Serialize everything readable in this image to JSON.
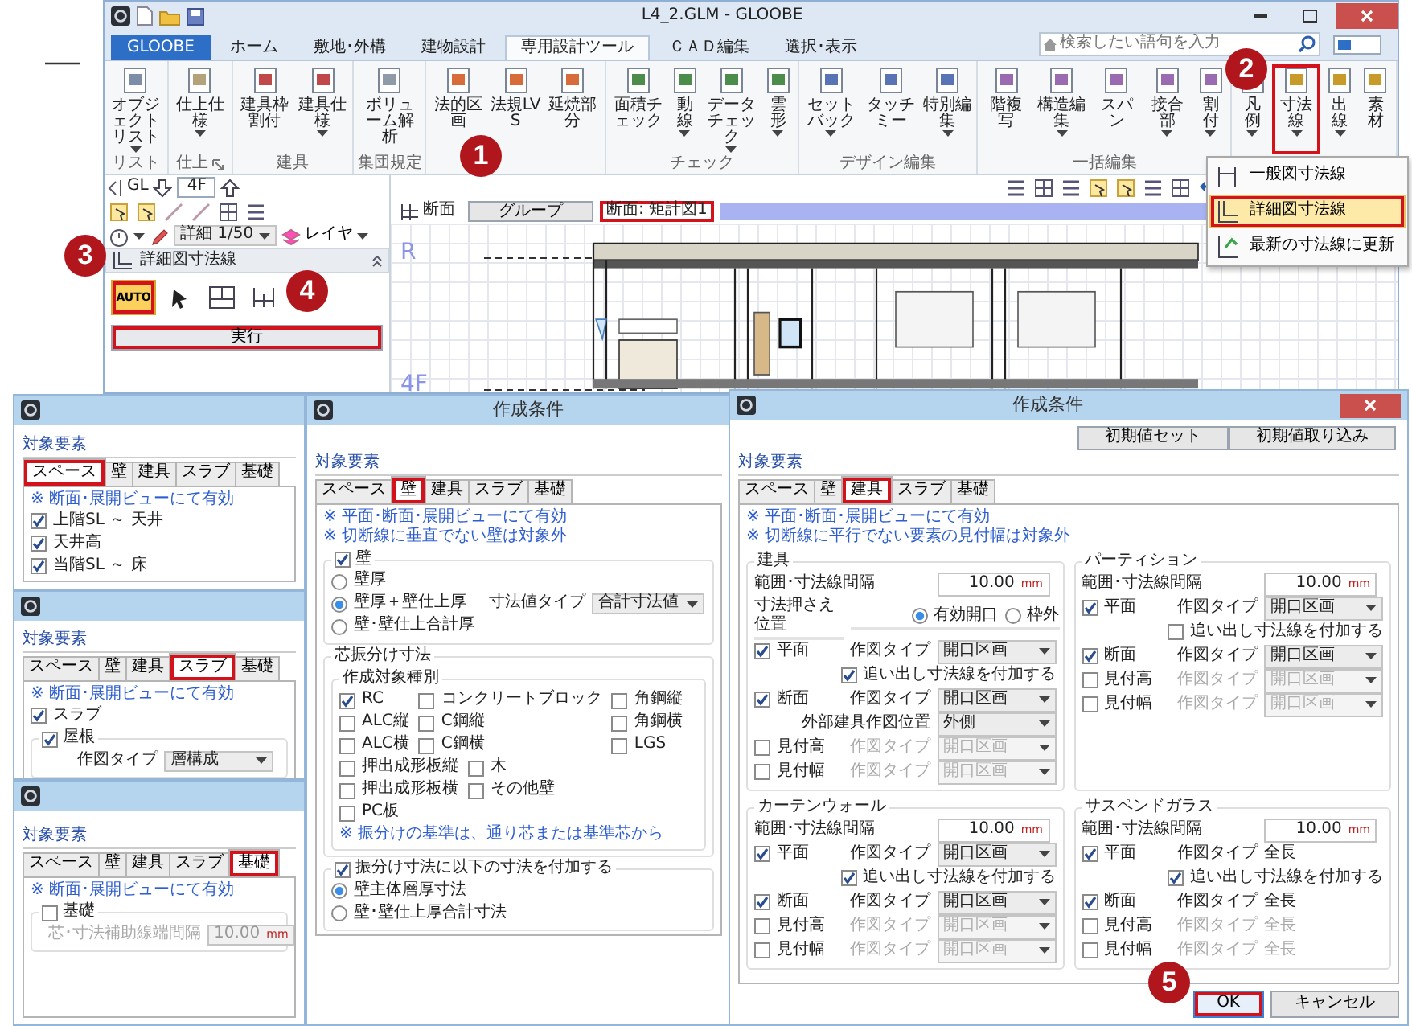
{
  "app": {
    "title": "L4_2.GLM - GLOOBE",
    "ribbon_tabs": [
      {
        "label": "GLOOBE",
        "kind": "file",
        "selected": false
      },
      {
        "label": "ホーム",
        "kind": "tab",
        "selected": false
      },
      {
        "label": "敷地･外構",
        "kind": "tab",
        "selected": false
      },
      {
        "label": "建物設計",
        "kind": "tab",
        "selected": false
      },
      {
        "label": "専用設計ツール",
        "kind": "tab",
        "selected": true
      },
      {
        "label": "ＣＡＤ編集",
        "kind": "tab",
        "selected": false
      },
      {
        "label": "選択･表示",
        "kind": "tab",
        "selected": false
      }
    ],
    "search": {
      "placeholder": "検索したい語句を入力"
    },
    "ribbon_groups": [
      {
        "label": "リスト",
        "launcher": false,
        "buttons": [
          {
            "label": "オブジェクトリスト",
            "dropdown": true,
            "highlighted": false
          }
        ]
      },
      {
        "label": "仕上",
        "launcher": true,
        "buttons": [
          {
            "label": "仕上仕様",
            "dropdown": true,
            "highlighted": false
          }
        ]
      },
      {
        "label": "建具",
        "launcher": false,
        "buttons": [
          {
            "label": "建具枠割付",
            "dropdown": false,
            "highlighted": false
          },
          {
            "label": "建具仕様",
            "dropdown": true,
            "highlighted": false
          }
        ]
      },
      {
        "label": "集団規定",
        "launcher": false,
        "buttons": [
          {
            "label": "ボリューム解析",
            "dropdown": false,
            "highlighted": false
          }
        ]
      },
      {
        "launcher": false,
        "buttons": [
          {
            "label": "法的区画",
            "dropdown": false,
            "highlighted": false
          },
          {
            "label": "法規LVS",
            "dropdown": false,
            "highlighted": false
          },
          {
            "label": "延焼部分",
            "dropdown": false,
            "highlighted": false
          }
        ]
      },
      {
        "label": "チェック",
        "launcher": false,
        "buttons": [
          {
            "label": "面積チェック",
            "dropdown": false,
            "highlighted": false
          },
          {
            "label": "動線",
            "dropdown": true,
            "highlighted": false
          },
          {
            "label": "データチェック",
            "dropdown": true,
            "highlighted": false
          },
          {
            "label": "雲形",
            "dropdown": true,
            "highlighted": false
          }
        ]
      },
      {
        "label": "デザイン編集",
        "launcher": false,
        "buttons": [
          {
            "label": "セットバック",
            "dropdown": true,
            "highlighted": false
          },
          {
            "label": "タッチミー",
            "dropdown": false,
            "highlighted": false
          },
          {
            "label": "特別編集",
            "dropdown": true,
            "highlighted": false
          }
        ]
      },
      {
        "label": "一括編集",
        "launcher": false,
        "buttons": [
          {
            "label": "階複写",
            "dropdown": false,
            "highlighted": false
          },
          {
            "label": "構造編集",
            "dropdown": true,
            "highlighted": false
          },
          {
            "label": "スパン",
            "dropdown": false,
            "highlighted": false
          },
          {
            "label": "接合部",
            "dropdown": true,
            "highlighted": false
          },
          {
            "label": "割付",
            "dropdown": true,
            "highlighted": false
          }
        ]
      },
      {
        "launcher": false,
        "buttons": [
          {
            "label": "凡例",
            "dropdown": true,
            "highlighted": false
          },
          {
            "label": "寸法線",
            "dropdown": true,
            "highlighted": true
          },
          {
            "label": "出線",
            "dropdown": true,
            "highlighted": false
          },
          {
            "label": "素材",
            "dropdown": false,
            "highlighted": false
          }
        ]
      }
    ],
    "floor_bar": {
      "level": "GL",
      "floor": "4F"
    },
    "view_bar": {
      "view_tab": "断面",
      "group_button": "グループ",
      "view_name": "断面: 矩計図1",
      "highlighted": true
    },
    "scale": "詳細 1/50",
    "layer": "レイヤ",
    "panel": {
      "title": "詳細図寸法線",
      "tools": [
        {
          "kind": "auto",
          "label": "AUTO",
          "selected": true,
          "highlighted": true
        },
        {
          "kind": "pointer",
          "selected": false,
          "highlighted": false
        },
        {
          "kind": "rooms",
          "selected": false,
          "highlighted": false
        },
        {
          "kind": "span",
          "selected": false,
          "highlighted": false
        }
      ],
      "run_button": {
        "label": "実行",
        "highlighted": true
      }
    },
    "canvas": {
      "level_labels": [
        "R",
        "4F"
      ]
    },
    "dimension_menu": [
      {
        "label": "一般図寸法線",
        "selected": false,
        "highlighted": false
      },
      {
        "label": "詳細図寸法線",
        "selected": true,
        "highlighted": true
      },
      {
        "label": "最新の寸法線に更新",
        "selected": false,
        "highlighted": false
      }
    ]
  },
  "callouts": [
    "1",
    "2",
    "3",
    "4",
    "5"
  ],
  "dialogs": [
    {
      "tabs_label": "対象要素",
      "tabs": [
        {
          "label": "スペース",
          "selected": true,
          "highlighted": true
        },
        {
          "label": "壁",
          "selected": false,
          "highlighted": false
        },
        {
          "label": "建具",
          "selected": false,
          "highlighted": false
        },
        {
          "label": "スラブ",
          "selected": false,
          "highlighted": false
        },
        {
          "label": "基礎",
          "selected": false,
          "highlighted": false
        }
      ],
      "items": [
        {
          "kind": "note",
          "text": "※ 断面･展開ビューにて有効"
        },
        {
          "kind": "check",
          "label": "上階SL ～ 天井",
          "checked": true
        },
        {
          "kind": "check",
          "label": "天井高",
          "checked": true
        },
        {
          "kind": "check",
          "label": "当階SL ～ 床",
          "checked": true
        }
      ],
      "closable": false
    },
    {
      "tabs_label": "対象要素",
      "tabs": [
        {
          "label": "スペース",
          "selected": false,
          "highlighted": false
        },
        {
          "label": "壁",
          "selected": false,
          "highlighted": false
        },
        {
          "label": "建具",
          "selected": false,
          "highlighted": false
        },
        {
          "label": "スラブ",
          "selected": true,
          "highlighted": true
        },
        {
          "label": "基礎",
          "selected": false,
          "highlighted": false
        }
      ],
      "items": [
        {
          "kind": "note",
          "text": "※ 断面･展開ビューにて有効"
        },
        {
          "kind": "check",
          "label": "スラブ",
          "checked": true
        },
        {
          "kind": "group",
          "label": "屋根",
          "checked": true,
          "children": [
            {
              "kind": "select",
              "label": "作図タイプ",
              "value": "層構成"
            }
          ]
        }
      ],
      "closable": false
    },
    {
      "tabs_label": "対象要素",
      "tabs": [
        {
          "label": "スペース",
          "selected": false,
          "highlighted": false
        },
        {
          "label": "壁",
          "selected": false,
          "highlighted": false
        },
        {
          "label": "建具",
          "selected": false,
          "highlighted": false
        },
        {
          "label": "スラブ",
          "selected": false,
          "highlighted": false
        },
        {
          "label": "基礎",
          "selected": true,
          "highlighted": true
        }
      ],
      "items": [
        {
          "kind": "note",
          "text": "※ 断面･展開ビューにて有効"
        },
        {
          "kind": "group",
          "label": "基礎",
          "checked": false,
          "children": [
            {
              "kind": "field",
              "label": "芯･寸法補助線端間隔",
              "value": "10.00",
              "unit": "mm",
              "disabled": true
            }
          ]
        }
      ],
      "closable": false
    },
    {
      "title": "作成条件",
      "tabs_label": "対象要素",
      "tabs": [
        {
          "label": "スペース",
          "selected": false,
          "highlighted": false
        },
        {
          "label": "壁",
          "selected": true,
          "highlighted": true
        },
        {
          "label": "建具",
          "selected": false,
          "highlighted": false
        },
        {
          "label": "スラブ",
          "selected": false,
          "highlighted": false
        },
        {
          "label": "基礎",
          "selected": false,
          "highlighted": false
        }
      ],
      "items": [
        {
          "kind": "note",
          "text": "※ 平面･断面･展開ビューにて有効"
        },
        {
          "kind": "note",
          "text": "※ 切断線に垂直でない壁は対象外"
        },
        {
          "kind": "group",
          "label": "壁",
          "checked": true,
          "children": [
            {
              "kind": "radio",
              "label": "壁厚",
              "selected": false
            },
            {
              "kind": "radio",
              "label": "壁厚＋壁仕上厚",
              "selected": true,
              "select": {
                "label": "寸法値タイプ",
                "value": "合計寸法値"
              }
            },
            {
              "kind": "radio",
              "label": "壁･壁仕上合計厚",
              "selected": false
            }
          ]
        },
        {
          "kind": "frame",
          "label": "芯振分け寸法",
          "children": [
            {
              "kind": "frame",
              "label": "作成対象種別",
              "children": [
                {
                  "kind": "grid",
                  "columns": [
                    [
                      {
                        "label": "RC",
                        "checked": true
                      },
                      {
                        "label": "ALC縦",
                        "checked": false
                      },
                      {
                        "label": "ALC横",
                        "checked": false
                      }
                    ],
                    [
                      {
                        "label": "コンクリートブロック",
                        "checked": false
                      },
                      {
                        "label": "C鋼縦",
                        "checked": false
                      },
                      {
                        "label": "C鋼横",
                        "checked": false
                      }
                    ],
                    [
                      {
                        "label": "角鋼縦",
                        "checked": false
                      },
                      {
                        "label": "角鋼横",
                        "checked": false
                      },
                      {
                        "label": "LGS",
                        "checked": false
                      }
                    ],
                    [
                      {
                        "label": "押出成形板縦",
                        "checked": false
                      },
                      {
                        "label": "押出成形板横",
                        "checked": false
                      },
                      {
                        "label": "PC板",
                        "checked": false
                      }
                    ],
                    [
                      {
                        "label": "木",
                        "checked": false
                      },
                      {
                        "label": "その他壁",
                        "checked": false
                      }
                    ]
                  ]
                },
                {
                  "kind": "note",
                  "text": "※ 振分けの基準は、通り芯または基準芯から"
                }
              ]
            }
          ]
        },
        {
          "kind": "group",
          "label": "振分け寸法に以下の寸法を付加する",
          "checked": true,
          "children": [
            {
              "kind": "radio",
              "label": "壁主体層厚寸法",
              "selected": true
            },
            {
              "kind": "radio",
              "label": "壁･壁仕上厚合計寸法",
              "selected": false
            }
          ]
        }
      ],
      "closable": false
    },
    {
      "title": "作成条件",
      "closable": true,
      "top_buttons": [
        "初期値セット",
        "初期値取り込み"
      ],
      "tabs_label": "対象要素",
      "tabs": [
        {
          "label": "スペース",
          "selected": false,
          "highlighted": false
        },
        {
          "label": "壁",
          "selected": false,
          "highlighted": false
        },
        {
          "label": "建具",
          "selected": true,
          "highlighted": true
        },
        {
          "label": "スラブ",
          "selected": false,
          "highlighted": false
        },
        {
          "label": "基礎",
          "selected": false,
          "highlighted": false
        }
      ],
      "notes": [
        "※ 平面･断面･展開ビューにて有効",
        "※ 切断線に平行でない要素の見付幅は対象外"
      ],
      "panels": [
        {
          "label": "建具",
          "rows": [
            {
              "kind": "field",
              "label": "範囲･寸法線間隔",
              "value": "10.00",
              "unit": "mm"
            },
            {
              "kind": "radios",
              "label": "寸法押さえ位置",
              "options": [
                {
                  "label": "有効開口",
                  "selected": true
                },
                {
                  "label": "枠外",
                  "selected": false
                }
              ]
            },
            {
              "kind": "view",
              "label": "平面",
              "checked": true,
              "type_label": "作図タイプ",
              "value": "開口区画",
              "disabled": false
            },
            {
              "kind": "subcheck",
              "label": "追い出し寸法線を付加する",
              "checked": true
            },
            {
              "kind": "view",
              "label": "断面",
              "checked": true,
              "type_label": "作図タイプ",
              "value": "開口区画",
              "disabled": false
            },
            {
              "kind": "select",
              "label": "外部建具作図位置",
              "value": "外側"
            },
            {
              "kind": "view",
              "label": "見付高",
              "checked": false,
              "type_label": "作図タイプ",
              "value": "開口区画",
              "disabled": true
            },
            {
              "kind": "view",
              "label": "見付幅",
              "checked": false,
              "type_label": "作図タイプ",
              "value": "開口区画",
              "disabled": true
            }
          ]
        },
        {
          "label": "パーティション",
          "rows": [
            {
              "kind": "field",
              "label": "範囲･寸法線間隔",
              "value": "10.00",
              "unit": "mm"
            },
            {
              "kind": "view",
              "label": "平面",
              "checked": true,
              "type_label": "作図タイプ",
              "value": "開口区画",
              "disabled": false
            },
            {
              "kind": "subcheck",
              "label": "追い出し寸法線を付加する",
              "checked": false
            },
            {
              "kind": "view",
              "label": "断面",
              "checked": true,
              "type_label": "作図タイプ",
              "value": "開口区画",
              "disabled": false
            },
            {
              "kind": "view",
              "label": "見付高",
              "checked": false,
              "type_label": "作図タイプ",
              "value": "開口区画",
              "disabled": true
            },
            {
              "kind": "view",
              "label": "見付幅",
              "checked": false,
              "type_label": "作図タイプ",
              "value": "開口区画",
              "disabled": true
            }
          ]
        },
        {
          "label": "カーテンウォール",
          "rows": [
            {
              "kind": "field",
              "label": "範囲･寸法線間隔",
              "value": "10.00",
              "unit": "mm"
            },
            {
              "kind": "view",
              "label": "平面",
              "checked": true,
              "type_label": "作図タイプ",
              "value": "開口区画",
              "disabled": false
            },
            {
              "kind": "subcheck",
              "label": "追い出し寸法線を付加する",
              "checked": true
            },
            {
              "kind": "view",
              "label": "断面",
              "checked": true,
              "type_label": "作図タイプ",
              "value": "開口区画",
              "disabled": false
            },
            {
              "kind": "view",
              "label": "見付高",
              "checked": false,
              "type_label": "作図タイプ",
              "value": "開口区画",
              "disabled": true
            },
            {
              "kind": "view",
              "label": "見付幅",
              "checked": false,
              "type_label": "作図タイプ",
              "value": "開口区画",
              "disabled": true
            }
          ]
        },
        {
          "label": "サスペンドガラス",
          "rows": [
            {
              "kind": "field",
              "label": "範囲･寸法線間隔",
              "value": "10.00",
              "unit": "mm"
            },
            {
              "kind": "view_text",
              "label": "平面",
              "checked": true,
              "type_label": "作図タイプ",
              "value": "全長",
              "disabled": false
            },
            {
              "kind": "subcheck",
              "label": "追い出し寸法線を付加する",
              "checked": true
            },
            {
              "kind": "view_text",
              "label": "断面",
              "checked": true,
              "type_label": "作図タイプ",
              "value": "全長",
              "disabled": false
            },
            {
              "kind": "view_text",
              "label": "見付高",
              "checked": false,
              "type_label": "作図タイプ",
              "value": "全長",
              "disabled": true
            },
            {
              "kind": "view_text",
              "label": "見付幅",
              "checked": false,
              "type_label": "作図タイプ",
              "value": "全長",
              "disabled": true
            }
          ]
        }
      ],
      "footer": [
        {
          "label": "OK",
          "default": true,
          "highlighted": true
        },
        {
          "label": "キャンセル",
          "default": false,
          "highlighted": false
        }
      ]
    }
  ]
}
